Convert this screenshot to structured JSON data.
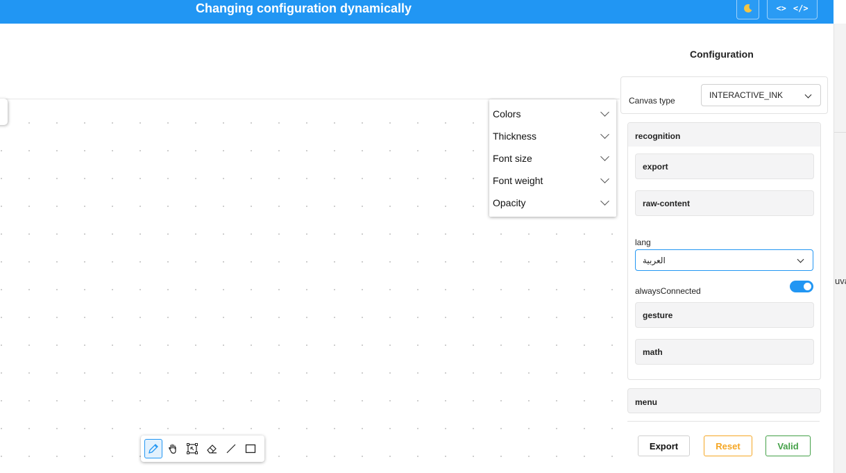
{
  "header": {
    "title": "Changing configuration dynamically",
    "theme_icon": "moon-icon",
    "code_toggle_left": "<>",
    "code_toggle_right": "</>"
  },
  "edge_text": "uva",
  "style_menu": {
    "items": [
      {
        "label": "Colors"
      },
      {
        "label": "Thickness"
      },
      {
        "label": "Font size"
      },
      {
        "label": "Font weight"
      },
      {
        "label": "Opacity"
      }
    ]
  },
  "config": {
    "title": "Configuration",
    "canvas_type": {
      "label": "Canvas type",
      "value": "INTERACTIVE_INK"
    },
    "recognition": {
      "title": "recognition",
      "export": "export",
      "raw_content": "raw-content",
      "lang_label": "lang",
      "lang_value": "العربية",
      "always_connected_label": "alwaysConnected",
      "always_connected": true,
      "gesture": "gesture",
      "math": "math"
    },
    "menu": {
      "title": "menu"
    }
  },
  "footer": {
    "export_label": "Export",
    "reset_label": "Reset",
    "valid_label": "Valid"
  },
  "toolbar": {
    "tools": [
      "pencil-icon",
      "hand-icon",
      "select-icon",
      "eraser-icon",
      "line-icon",
      "rectangle-icon"
    ],
    "active_tool": "pencil-icon"
  },
  "colors": {
    "accent": "#2196f3",
    "reset": "#f5a623",
    "valid": "#43a047"
  }
}
